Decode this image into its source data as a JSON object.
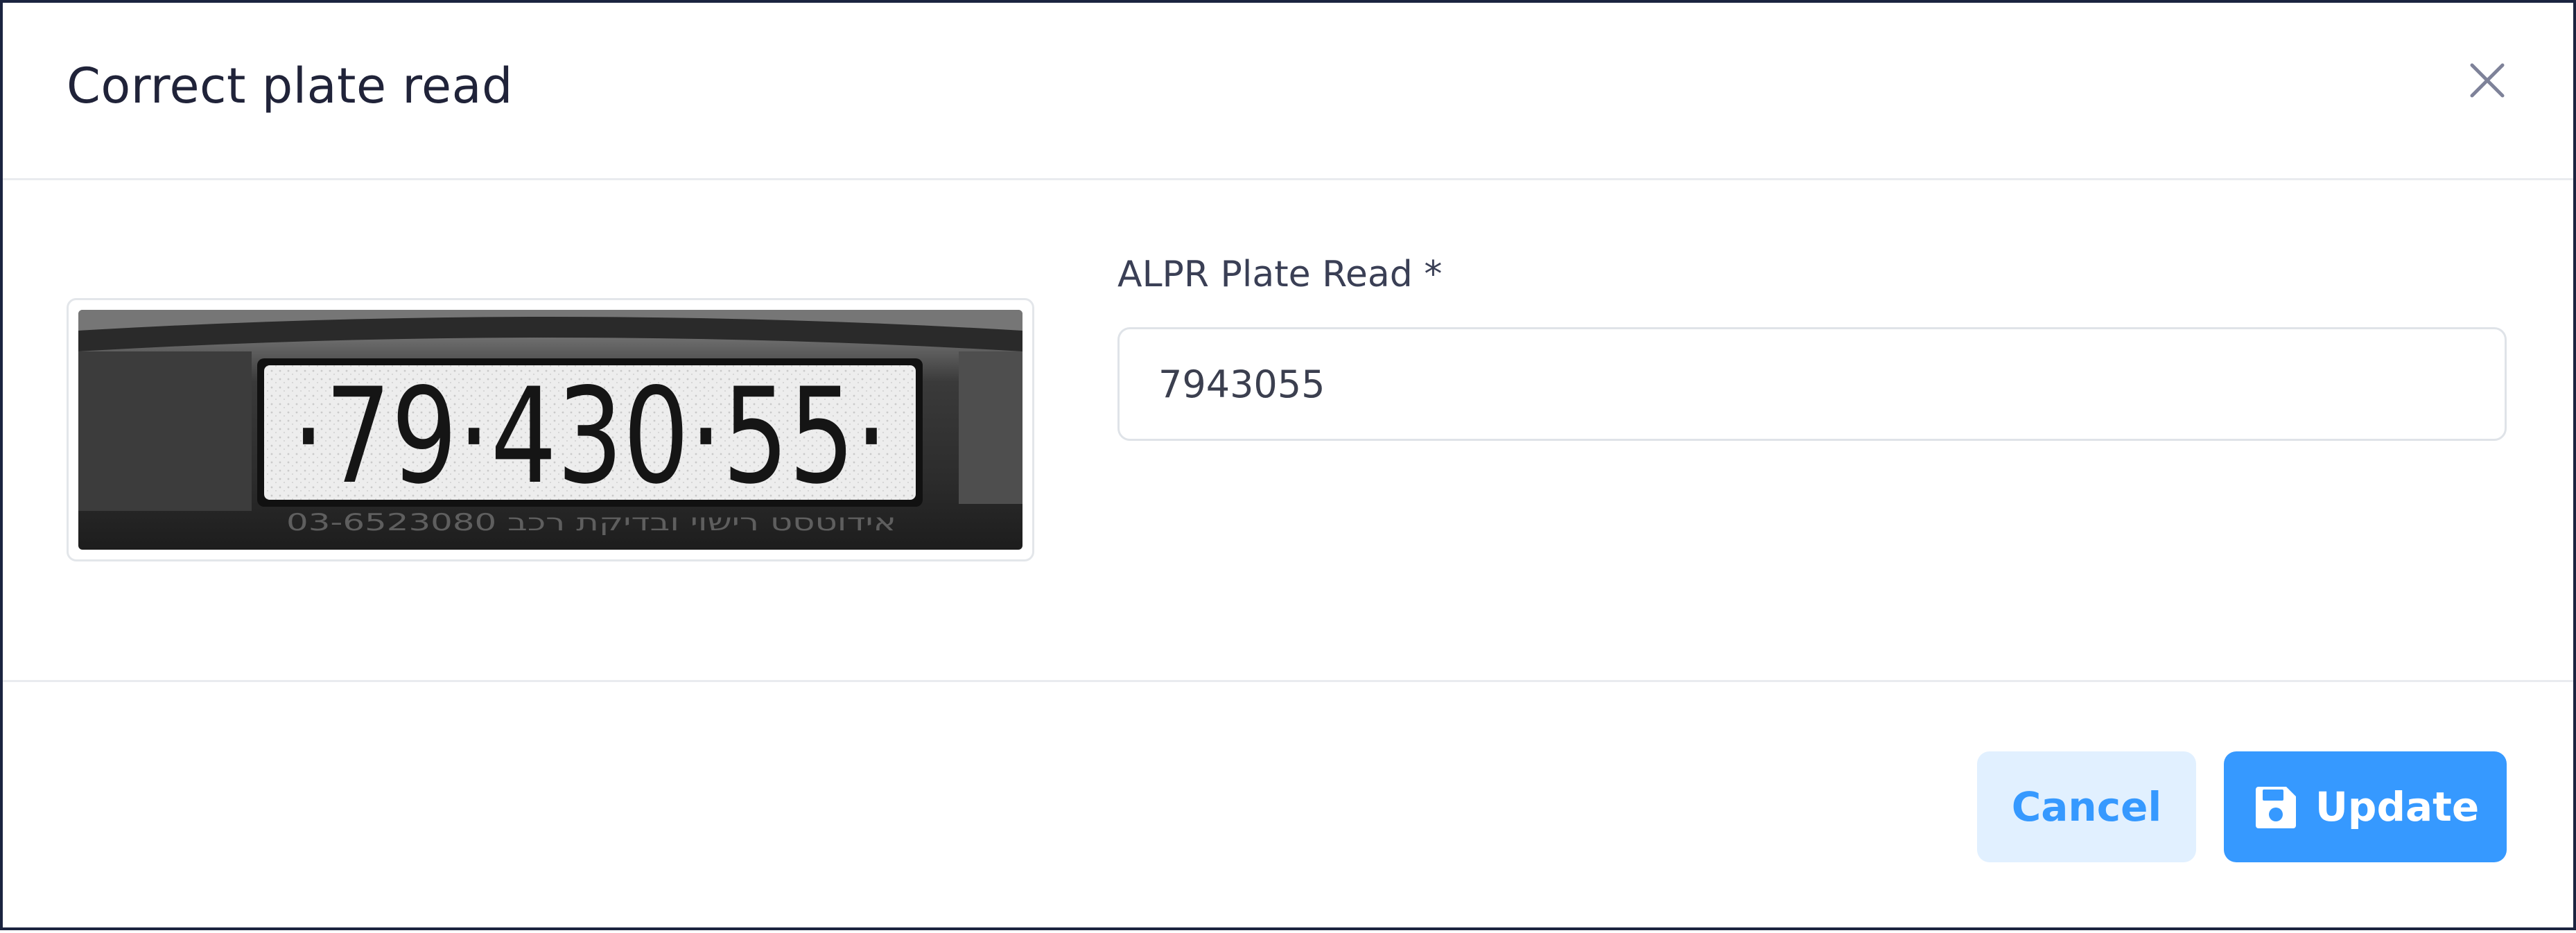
{
  "dialog": {
    "title": "Correct plate read"
  },
  "plate_image": {
    "plate_text": "·79·430·55·",
    "dealer_text": "03-6523080  אידוטסט רישוי ובדיקת רכב"
  },
  "form": {
    "label": "ALPR Plate Read *",
    "value": "7943055"
  },
  "footer": {
    "cancel_label": "Cancel",
    "update_label": "Update"
  },
  "colors": {
    "primary": "#3699ff",
    "primary_light": "#e1f0ff",
    "title": "#202339",
    "border": "#e9ebef"
  },
  "icons": {
    "close": "close-icon",
    "save": "floppy-disk-icon"
  }
}
